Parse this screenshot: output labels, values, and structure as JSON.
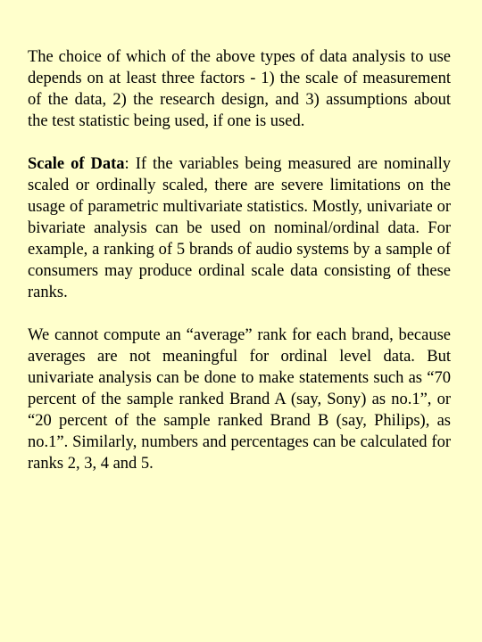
{
  "document": {
    "background_color": "#ffffcc",
    "paragraphs": [
      {
        "lead": "",
        "text": "The choice of which of the above types of data analysis to use depends on at least three factors - 1) the scale of measurement of the data, 2) the research design, and 3) assumptions about the test statistic being used, if one is used."
      },
      {
        "lead": "Scale of Data",
        "text": ": If the variables being measured are nominally scaled  or ordinally scaled, there are severe limitations on the usage of parametric multivariate statistics. Mostly, univariate or bivariate analysis can be used on nominal/ordinal data. For example, a ranking of 5 brands of audio systems by a sample of consumers may produce ordinal scale data consisting of these ranks."
      },
      {
        "lead": "",
        "text": "We cannot compute an “average” rank for each brand, because averages are not meaningful for ordinal level data. But univariate analysis can be done to make statements such as “70 percent of the sample ranked Brand A (say, Sony) as no.1”, or “20 percent of the sample ranked Brand B (say, Philips), as no.1”. Similarly, numbers and percentages can be calculated for ranks 2, 3, 4 and 5."
      }
    ]
  }
}
